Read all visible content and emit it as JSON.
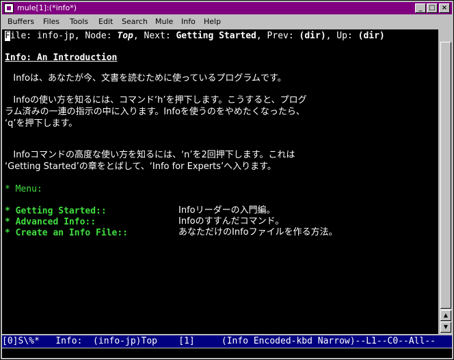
{
  "window": {
    "title": "mule[1]:(*info*)"
  },
  "menubar": {
    "items": [
      "Buffers",
      "Files",
      "Tools",
      "Edit",
      "Search",
      "Mule",
      "Info",
      "Help"
    ]
  },
  "header": {
    "cursor_char": "F",
    "text1": "ile: info-jp, Node: ",
    "node": "Top",
    "text2": ", Next: ",
    "next": "Getting Started",
    "text3": ", Prev: ",
    "prev": "(dir)",
    "text4": ", Up: ",
    "up": "(dir)"
  },
  "content": {
    "title": "Info: An Introduction",
    "p1": "   Infoは、あなたが今、文書を読むために使っているプログラムです。",
    "p2a": "   Infoの使い方を知るには、コマンド‘h’を押下します。こうすると、プログ",
    "p2b": "ラム済みの一連の指示の中に入ります。Infoを使うのをやめたくなったら、",
    "p2c": "‘q’を押下します。",
    "p3a": "   Infoコマンドの高度な使い方を知るには、‘n’を2回押下します。これは",
    "p3b": "‘Getting Started’の章をとばして、‘Info for Experts’へ入ります。",
    "menu_header": "* Menu:",
    "menu": [
      {
        "label": "* Getting Started::",
        "desc": "Infoリーダーの入門編。"
      },
      {
        "label": "* Advanced Info::",
        "desc": "Infoのすすんだコマンド。"
      },
      {
        "label": "* Create an Info File::",
        "desc": "あなただけのInfoファイルを作る方法。"
      }
    ]
  },
  "modeline": {
    "text": "[0]S\\%*   Info:  (info-jp)Top    [1]     (Info Encoded-kbd Narrow)--L1--C0--All--"
  },
  "colors": {
    "titlebar": "#800080",
    "modeline": "#000080",
    "menu_items": "#40e040",
    "background": "#000000"
  }
}
